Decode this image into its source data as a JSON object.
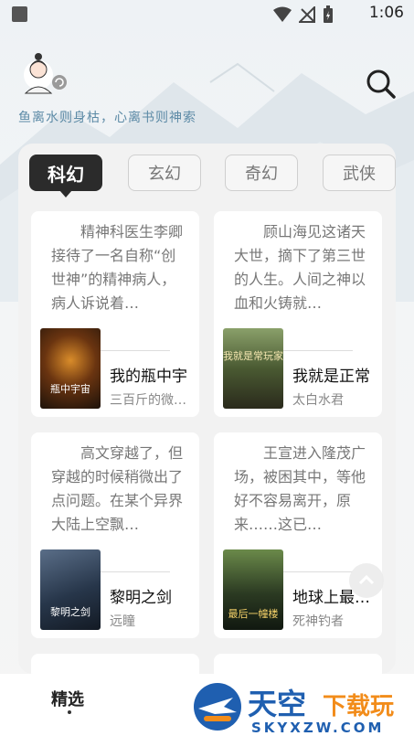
{
  "status_bar": {
    "time": "1:06"
  },
  "header": {
    "slogan": "鱼离水则身枯，心离书则神索",
    "search_icon": "search-icon",
    "avatar_icon": "avatar-refresh-icon"
  },
  "tabs": [
    {
      "label": "科幻",
      "active": true
    },
    {
      "label": "玄幻",
      "active": false
    },
    {
      "label": "奇幻",
      "active": false
    },
    {
      "label": "武侠",
      "active": false
    }
  ],
  "books": [
    {
      "desc": "精神科医生李卿接待了一名自称“创世神”的精神病人，病人诉说着…",
      "title": "我的瓶中宇",
      "author": "三百斤的微…",
      "cover_text": "瓶中宇宙",
      "cover_color": "#3a2a18"
    },
    {
      "desc": "顾山海见这诸天大世，摘下了第三世的人生。人间之神以血和火铸就…",
      "title": "我就是正常",
      "author": "太白水君",
      "cover_text": "我就是常玩家",
      "cover_color": "#5b6b3a"
    },
    {
      "desc": "高文穿越了，但穿越的时候稍微出了点问题。在某个异界大陆上空飘…",
      "title": "黎明之剑",
      "author": "远瞳",
      "cover_text": "黎明之剑",
      "cover_color": "#233248"
    },
    {
      "desc": "王宣进入隆茂广场，被困其中，等他好不容易离开，原来……这已…",
      "title": "地球上最…",
      "author": "死神钓者",
      "cover_text": "最后一幢楼",
      "cover_color": "#2e3d2a"
    }
  ],
  "bottom_nav": {
    "selected_label": "精选"
  },
  "watermark": {
    "brand": "天空下载玩",
    "url": "SKYXZW.COM"
  }
}
